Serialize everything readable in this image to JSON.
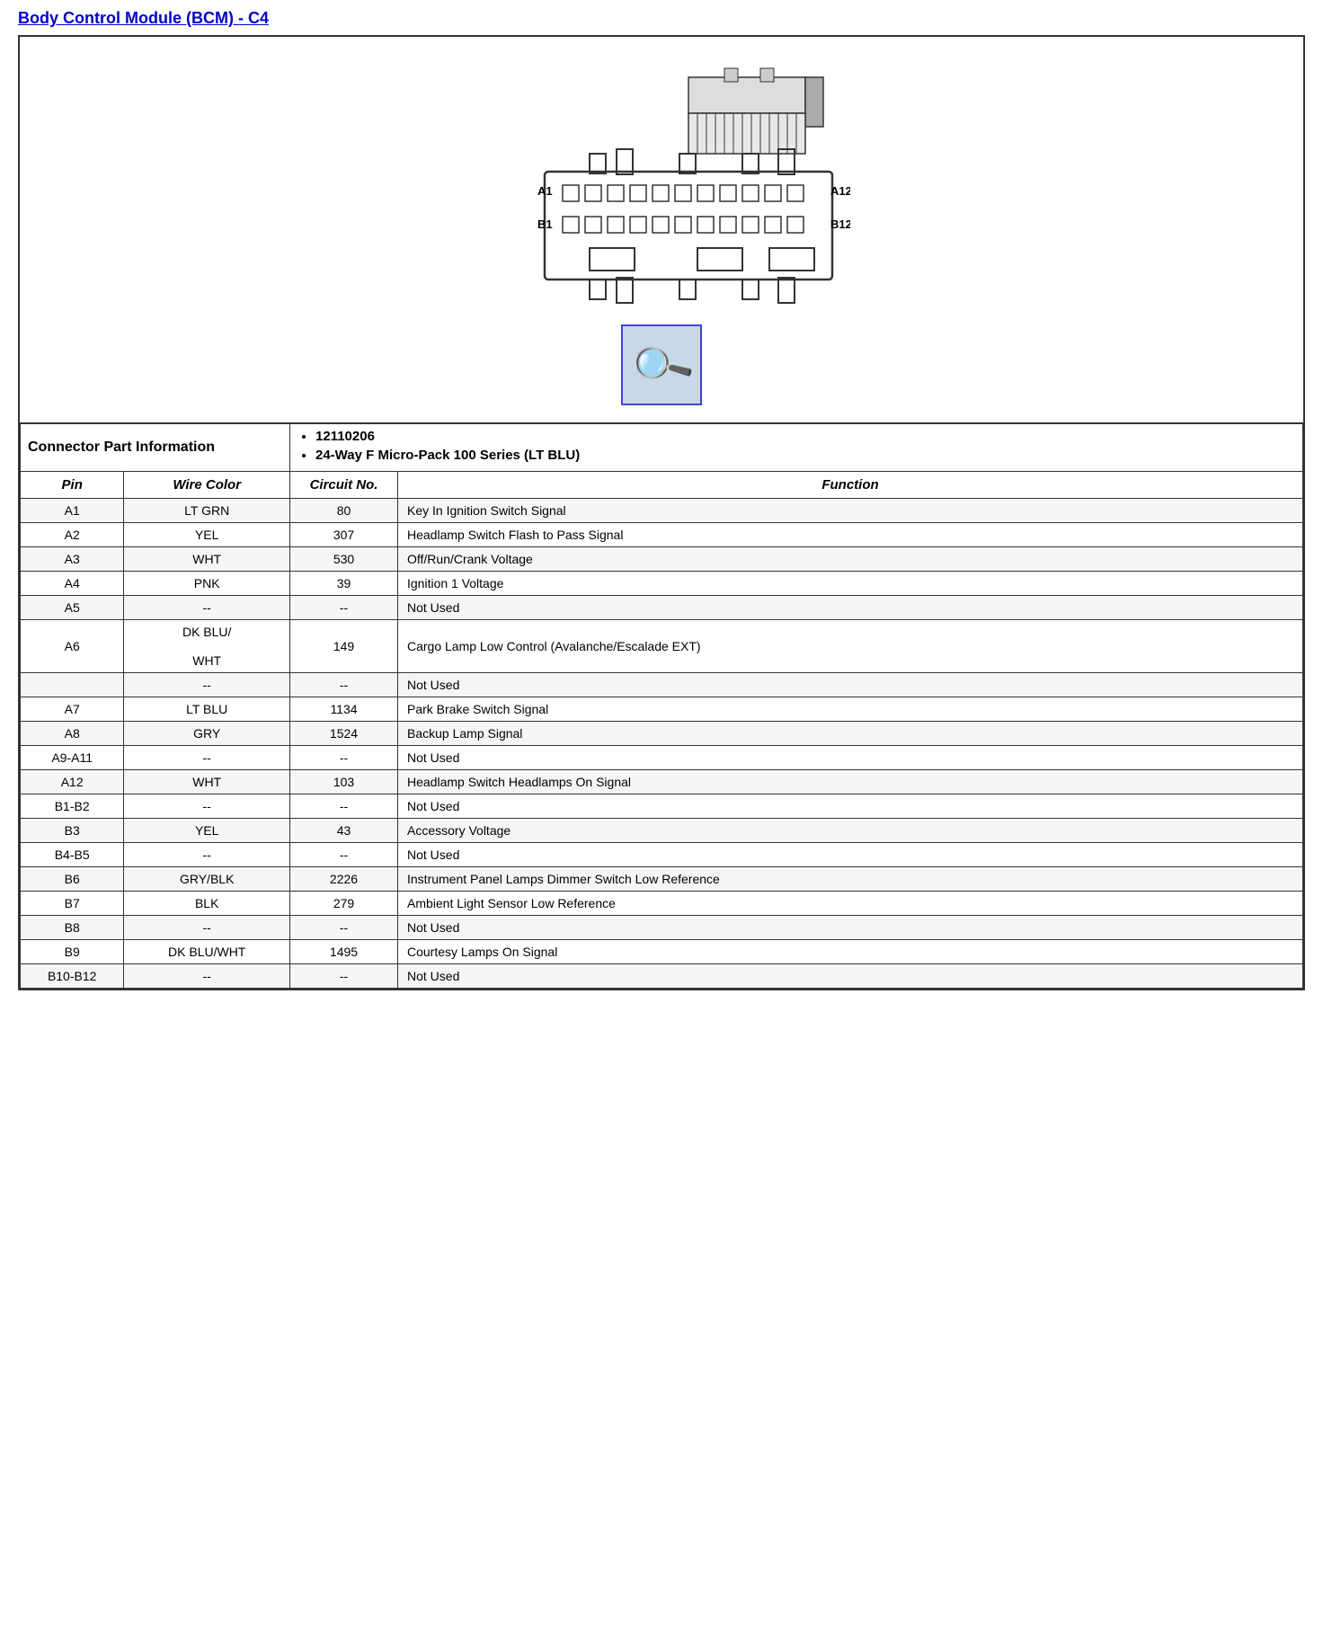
{
  "title": "Body Control Module (BCM) - C4",
  "connector_info_label": "Connector Part Information",
  "connector_parts": [
    "12110206",
    "24-Way F Micro-Pack 100 Series (LT BLU)"
  ],
  "table_headers": {
    "pin": "Pin",
    "wire_color": "Wire Color",
    "circuit_no": "Circuit No.",
    "function": "Function"
  },
  "rows": [
    {
      "pin": "A1",
      "wire_color": "LT GRN",
      "circuit_no": "80",
      "function": "Key In Ignition Switch Signal"
    },
    {
      "pin": "A2",
      "wire_color": "YEL",
      "circuit_no": "307",
      "function": "Headlamp Switch Flash to Pass Signal"
    },
    {
      "pin": "A3",
      "wire_color": "WHT",
      "circuit_no": "530",
      "function": "Off/Run/Crank Voltage"
    },
    {
      "pin": "A4",
      "wire_color": "PNK",
      "circuit_no": "39",
      "function": "Ignition 1 Voltage"
    },
    {
      "pin": "A5",
      "wire_color": "--",
      "circuit_no": "--",
      "function": "Not Used"
    },
    {
      "pin": "A6",
      "wire_color": "DK BLU/\n\nWHT",
      "circuit_no": "149",
      "function": "Cargo Lamp Low Control (Avalanche/Escalade EXT)"
    },
    {
      "pin": "",
      "wire_color": "--",
      "circuit_no": "--",
      "function": "Not Used"
    },
    {
      "pin": "A7",
      "wire_color": "LT BLU",
      "circuit_no": "1134",
      "function": "Park Brake Switch Signal"
    },
    {
      "pin": "A8",
      "wire_color": "GRY",
      "circuit_no": "1524",
      "function": "Backup Lamp Signal"
    },
    {
      "pin": "A9-A11",
      "wire_color": "--",
      "circuit_no": "--",
      "function": "Not Used"
    },
    {
      "pin": "A12",
      "wire_color": "WHT",
      "circuit_no": "103",
      "function": "Headlamp Switch Headlamps On Signal"
    },
    {
      "pin": "B1-B2",
      "wire_color": "--",
      "circuit_no": "--",
      "function": "Not Used"
    },
    {
      "pin": "B3",
      "wire_color": "YEL",
      "circuit_no": "43",
      "function": "Accessory Voltage"
    },
    {
      "pin": "B4-B5",
      "wire_color": "--",
      "circuit_no": "--",
      "function": "Not Used"
    },
    {
      "pin": "B6",
      "wire_color": "GRY/BLK",
      "circuit_no": "2226",
      "function": "Instrument Panel Lamps Dimmer Switch Low Reference"
    },
    {
      "pin": "B7",
      "wire_color": "BLK",
      "circuit_no": "279",
      "function": "Ambient Light Sensor Low Reference"
    },
    {
      "pin": "B8",
      "wire_color": "--",
      "circuit_no": "--",
      "function": "Not Used"
    },
    {
      "pin": "B9",
      "wire_color": "DK BLU/WHT",
      "circuit_no": "1495",
      "function": "Courtesy Lamps On Signal"
    },
    {
      "pin": "B10-B12",
      "wire_color": "--",
      "circuit_no": "--",
      "function": "Not Used"
    }
  ]
}
